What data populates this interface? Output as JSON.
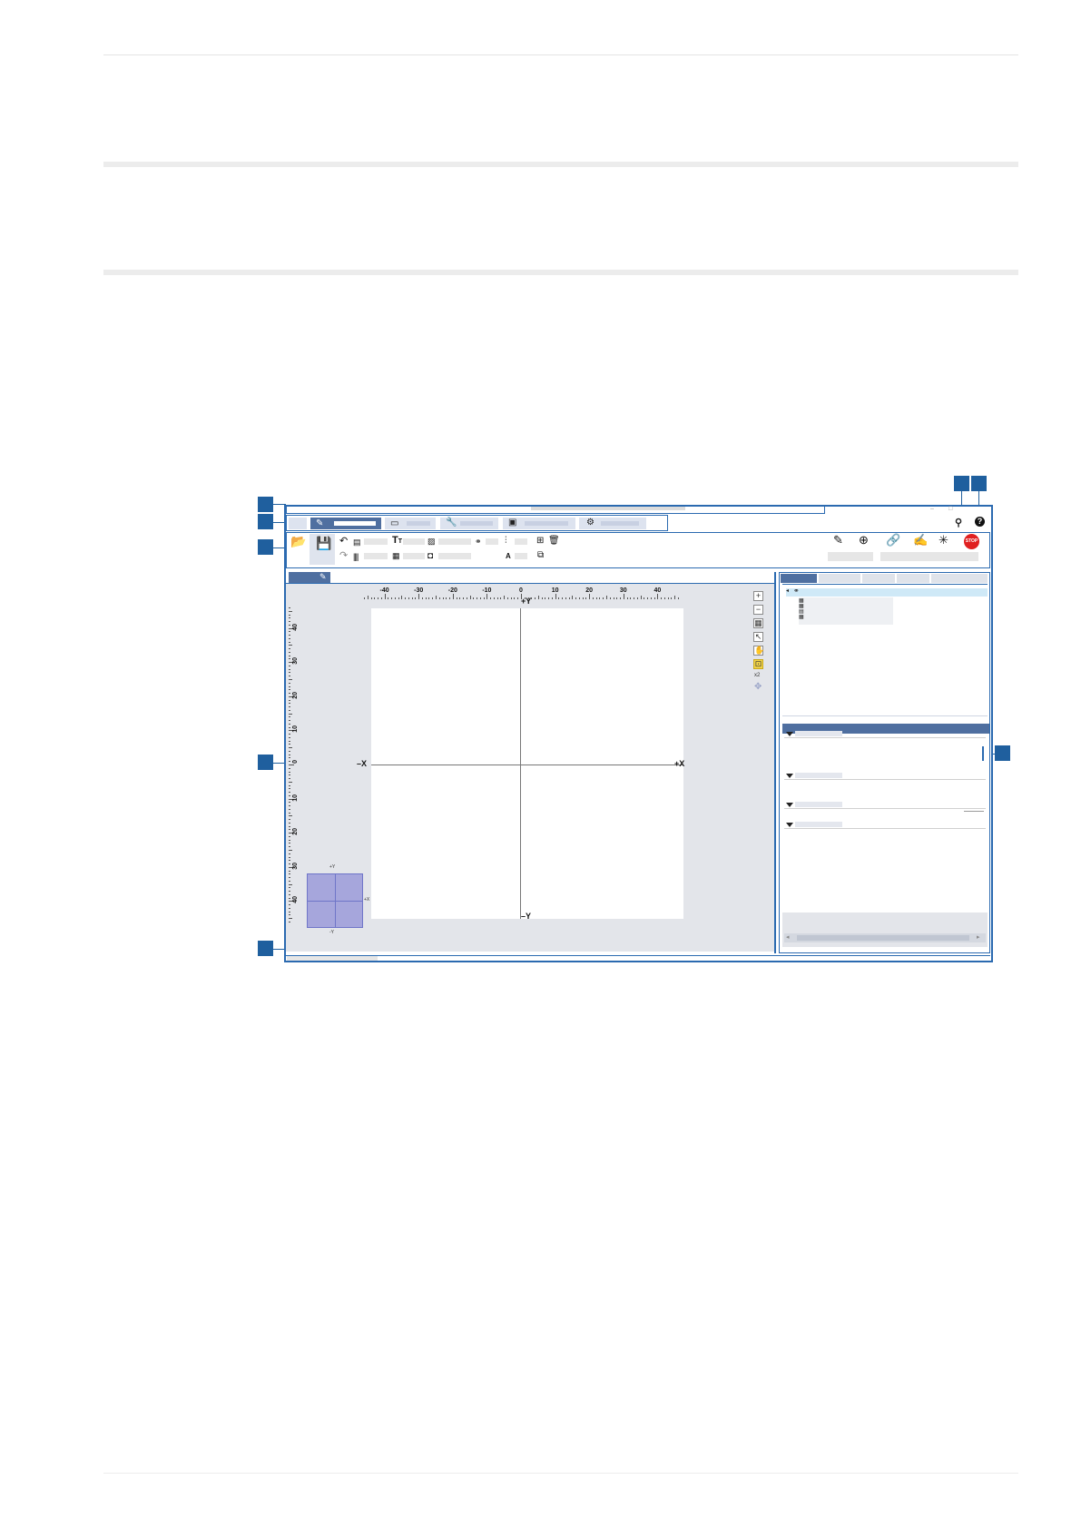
{
  "window": {
    "title": "",
    "tabs": [
      {
        "label": "",
        "active": false
      },
      {
        "label": "",
        "icon": "edit-icon",
        "active": true
      },
      {
        "label": "",
        "icon": "monitor-icon",
        "active": false
      },
      {
        "label": "",
        "icon": "wrench-icon",
        "active": false
      },
      {
        "label": "",
        "icon": "clipboard-icon",
        "active": false
      },
      {
        "label": "",
        "icon": "gear-icon",
        "active": false
      }
    ],
    "help_icon": "help-icon",
    "user_icon": "user-icon"
  },
  "canvas": {
    "x_ticks": [
      "-40",
      "-30",
      "-20",
      "-10",
      "0",
      "10",
      "20",
      "30",
      "40"
    ],
    "y_ticks": [
      "40",
      "30",
      "20",
      "10",
      "0",
      "10",
      "20",
      "30",
      "40"
    ],
    "axis_labels": {
      "pos_y": "+Y",
      "neg_y": "–Y",
      "neg_x": "–X",
      "pos_x": "+X"
    },
    "minimap_labels": {
      "pos_y": "+Y",
      "neg_y": "-Y",
      "pos_x": "+X"
    },
    "zoom_level": "x2"
  },
  "ribbon": {
    "stop_label": "STOP"
  },
  "colors": {
    "accent": "#2b6ab0",
    "callout": "#1f5f9e",
    "tab_active": "#4f6fa0",
    "minimap": "#a6a6dc",
    "stop": "#e02020"
  }
}
